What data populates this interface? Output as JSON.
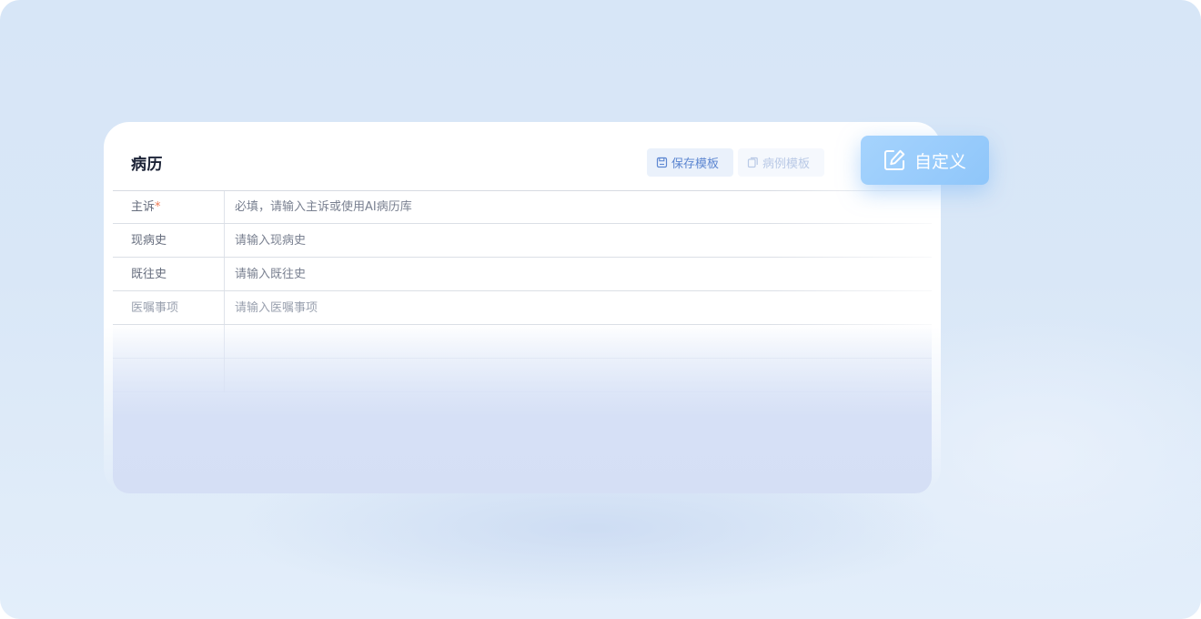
{
  "card": {
    "title": "病历",
    "save_template_label": "保存模板",
    "case_template_label": "病例模板"
  },
  "form": {
    "rows": [
      {
        "label": "主诉",
        "required_mark": "*",
        "placeholder": "必填，请输入主诉或使用AI病历库"
      },
      {
        "label": "现病史",
        "placeholder": "请输入现病史"
      },
      {
        "label": "既往史",
        "placeholder": "请输入既往史"
      },
      {
        "label": "医嘱事项",
        "placeholder": "请输入医嘱事项"
      }
    ]
  },
  "custom_button": {
    "label": "自定义",
    "icon": "edit-icon"
  },
  "colors": {
    "background": "#d8e6f7",
    "accent": "#5c86d1",
    "required": "#f07c55",
    "custom_button": "#9ccdfb"
  }
}
